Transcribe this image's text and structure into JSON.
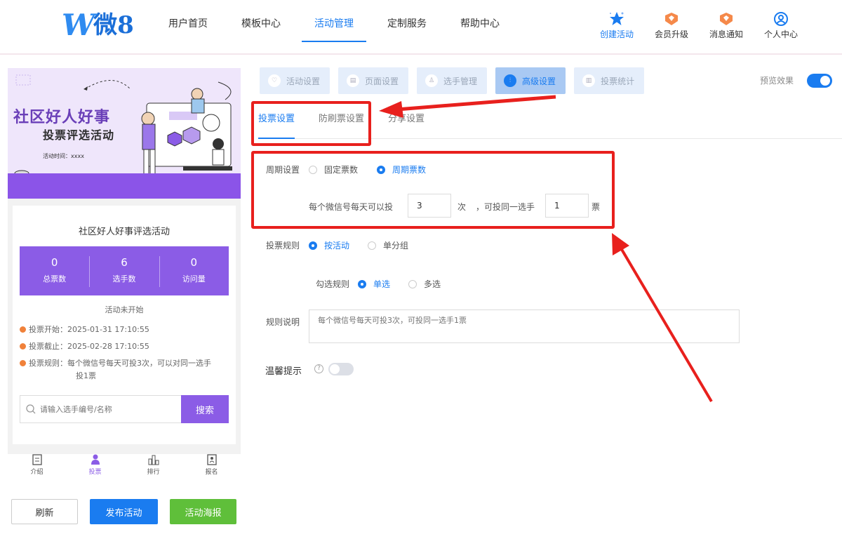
{
  "header": {
    "logo_text": "微8",
    "nav": [
      "用户首页",
      "模板中心",
      "活动管理",
      "定制服务",
      "帮助中心"
    ],
    "right_buttons": [
      "创建活动",
      "会员升级",
      "消息通知",
      "个人中心"
    ]
  },
  "preview": {
    "banner": {
      "title": "社区好人好事",
      "subtitle": "投票评选活动",
      "time": "活动时间：xxxx"
    },
    "card_title": "社区好人好事评选活动",
    "stats": [
      {
        "num": "0",
        "label": "总票数"
      },
      {
        "num": "6",
        "label": "选手数"
      },
      {
        "num": "0",
        "label": "访问量"
      }
    ],
    "status": "活动未开始",
    "info": {
      "start": "投票开始：2025-01-31 17:10:55",
      "end": "投票截止：2025-02-28 17:10:55",
      "rule_line1": "投票规则：每个微信号每天可投3次，可以对同一选手",
      "rule_line2": "投1票"
    },
    "search_placeholder": "请输入选手编号/名称",
    "search_button": "搜索",
    "tabbar": [
      "介绍",
      "投票",
      "排行",
      "报名"
    ]
  },
  "actions": {
    "refresh": "刷新",
    "publish": "发布活动",
    "poster": "活动海报"
  },
  "settings": {
    "steps": [
      "活动设置",
      "页面设置",
      "选手管理",
      "高级设置",
      "投票统计"
    ],
    "active_step": "高级设置",
    "preview_label": "预览效果",
    "preview_on": true,
    "sub_tabs": [
      "投票设置",
      "防刷票设置",
      "分享设置"
    ],
    "period": {
      "label": "周期设置",
      "options": [
        "固定票数",
        "周期票数"
      ],
      "selected": "周期票数"
    },
    "per_day": {
      "prefix": "每个微信号每天可以投",
      "times_value": "3",
      "times_unit": "次",
      "same_prefix": "，可投同一选手",
      "votes_value": "1",
      "votes_unit": "票"
    },
    "vote_rule": {
      "label": "投票规则",
      "options": [
        "按活动",
        "单分组"
      ],
      "selected": "按活动"
    },
    "select_rule": {
      "label": "勾选规则",
      "options": [
        "单选",
        "多选"
      ],
      "selected": "单选"
    },
    "rule_desc": {
      "label": "规则说明",
      "placeholder": "每个微信号每天可投3次，可投同一选手1票"
    },
    "tip": {
      "label": "温馨提示",
      "help": "?",
      "enabled": false
    }
  },
  "colors": {
    "primary": "#1a7cf0",
    "purple": "#8b5ce6",
    "green": "#5fbf3a",
    "annotation_red": "#e8201d"
  }
}
